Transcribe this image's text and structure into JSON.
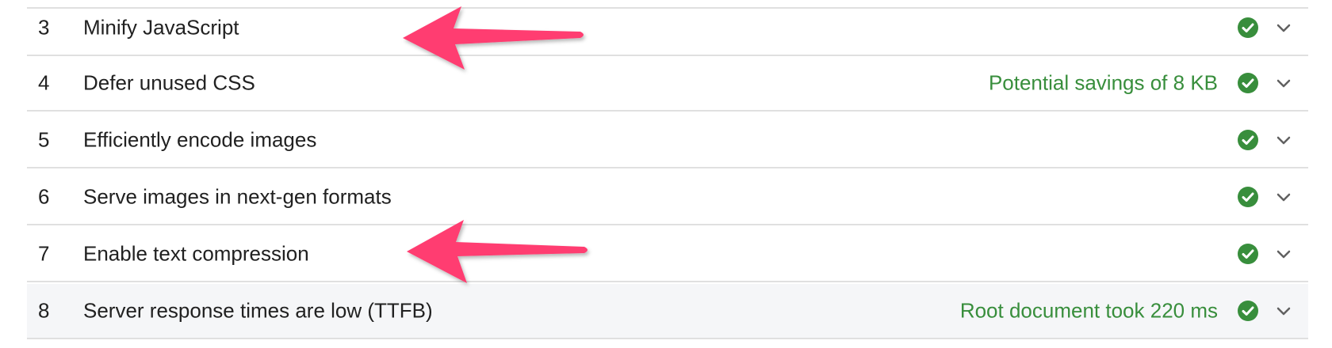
{
  "audits": [
    {
      "index": "3",
      "title": "Minify JavaScript",
      "display_value": "",
      "status": "pass"
    },
    {
      "index": "4",
      "title": "Defer unused CSS",
      "display_value": "Potential savings of 8 KB",
      "status": "pass"
    },
    {
      "index": "5",
      "title": "Efficiently encode images",
      "display_value": "",
      "status": "pass"
    },
    {
      "index": "6",
      "title": "Serve images in next-gen formats",
      "display_value": "",
      "status": "pass"
    },
    {
      "index": "7",
      "title": "Enable text compression",
      "display_value": "",
      "status": "pass"
    },
    {
      "index": "8",
      "title": "Server response times are low (TTFB)",
      "display_value": "Root document took 220 ms",
      "status": "pass"
    }
  ],
  "colors": {
    "pass": "#388e3c",
    "annotation_arrow": "#ff3d71",
    "divider": "#e0e0e0"
  },
  "icons": [
    "check-circle-icon",
    "chevron-down-icon",
    "annotation-arrow"
  ]
}
